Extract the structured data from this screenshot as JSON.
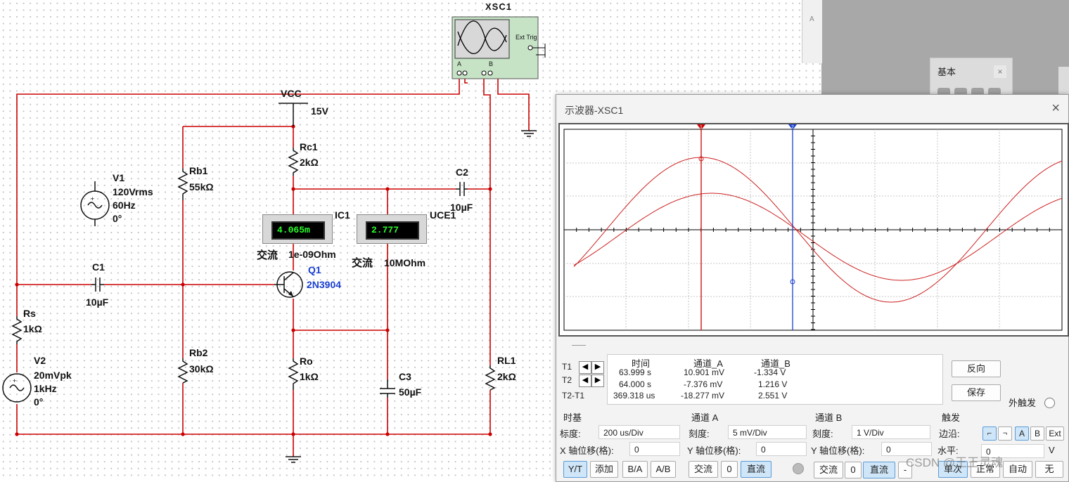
{
  "schematic": {
    "xsc1_label": "XSC1",
    "ext_trig": "Ext Trig",
    "port_a": "A",
    "port_b": "B",
    "vcc_label": "VCC",
    "vcc_value": "15V",
    "rc1_name": "Rc1",
    "rc1_value": "2kΩ",
    "rb1_name": "Rb1",
    "rb1_value": "55kΩ",
    "rb2_name": "Rb2",
    "rb2_value": "30kΩ",
    "ro_name": "Ro",
    "ro_value": "1kΩ",
    "rs_name": "Rs",
    "rs_value": "1kΩ",
    "rl1_name": "RL1",
    "rl1_value": "2kΩ",
    "c1_name": "C1",
    "c1_value": "10µF",
    "c2_name": "C2",
    "c2_value": "10µF",
    "c3_name": "C3",
    "c3_value": "50µF",
    "v1_name": "V1",
    "v1_amp": "120Vrms",
    "v1_freq": "60Hz",
    "v1_phase": "0°",
    "v2_name": "V2",
    "v2_amp": "20mVpk",
    "v2_freq": "1kHz",
    "v2_phase": "0°",
    "q1_name": "Q1",
    "q1_model": "2N3904",
    "ic1_name": "IC1",
    "ic1_reading": "4.065m",
    "ic1_mode": "交流",
    "ic1_res": "1e-09Ohm",
    "uce1_name": "UCE1",
    "uce1_reading": "2.777",
    "uce1_mode": "交流",
    "uce1_res": "10MOhm",
    "side_letter": "A"
  },
  "colors": {
    "wire": "#cc0000",
    "trace": "#cc2020",
    "cursor1": "#cc0000",
    "cursor2": "#1a3fd0",
    "meter_text": "#2aff2a",
    "selected": "#cfe6f9"
  },
  "basic_panel": {
    "title": "基本",
    "close": "×"
  },
  "scope": {
    "title": "示波器-XSC1",
    "close_icon": "×",
    "cursor1_label": "1",
    "cursor2_label": "2",
    "readout": {
      "headers": [
        "时间",
        "通道_A",
        "通道_B"
      ],
      "rows": [
        {
          "label": "T1",
          "time": "63.999 s",
          "a": "10.901 mV",
          "b": "-1.334 V"
        },
        {
          "label": "T2",
          "time": "64.000 s",
          "a": "-7.376 mV",
          "b": "1.216 V"
        },
        {
          "label": "T2-T1",
          "time": "369.318 us",
          "a": "-18.277 mV",
          "b": "2.551 V"
        }
      ]
    },
    "reverse_btn": "反向",
    "save_btn": "保存",
    "ext_trigger": "外触发",
    "timebase": {
      "header": "时基",
      "scale_label": "标度:",
      "scale_value": "200 us/Div",
      "xpos_label": "X 轴位移(格):",
      "xpos_value": "0",
      "buttons": [
        "Y/T",
        "添加",
        "B/A",
        "A/B"
      ]
    },
    "channel_a": {
      "header": "通道 A",
      "scale_label": "刻度:",
      "scale_value": "5 mV/Div",
      "ypos_label": "Y 轴位移(格):",
      "ypos_value": "0",
      "buttons": [
        "交流",
        "0",
        "直流"
      ]
    },
    "channel_b": {
      "header": "通道 B",
      "scale_label": "刻度:",
      "scale_value": "1  V/Div",
      "ypos_label": "Y 轴位移(格):",
      "ypos_value": "0",
      "buttons": [
        "交流",
        "0",
        "直流",
        "-"
      ]
    },
    "trigger": {
      "header": "触发",
      "edge_label": "边沿:",
      "edge_buttons": [
        "A",
        "B",
        "Ext"
      ],
      "level_label": "水平:",
      "level_value": "0",
      "level_unit": "V",
      "mode_buttons": [
        "单次",
        "正常",
        "自动",
        "无"
      ]
    }
  },
  "watermark": "CSDN @王王灵魂"
}
